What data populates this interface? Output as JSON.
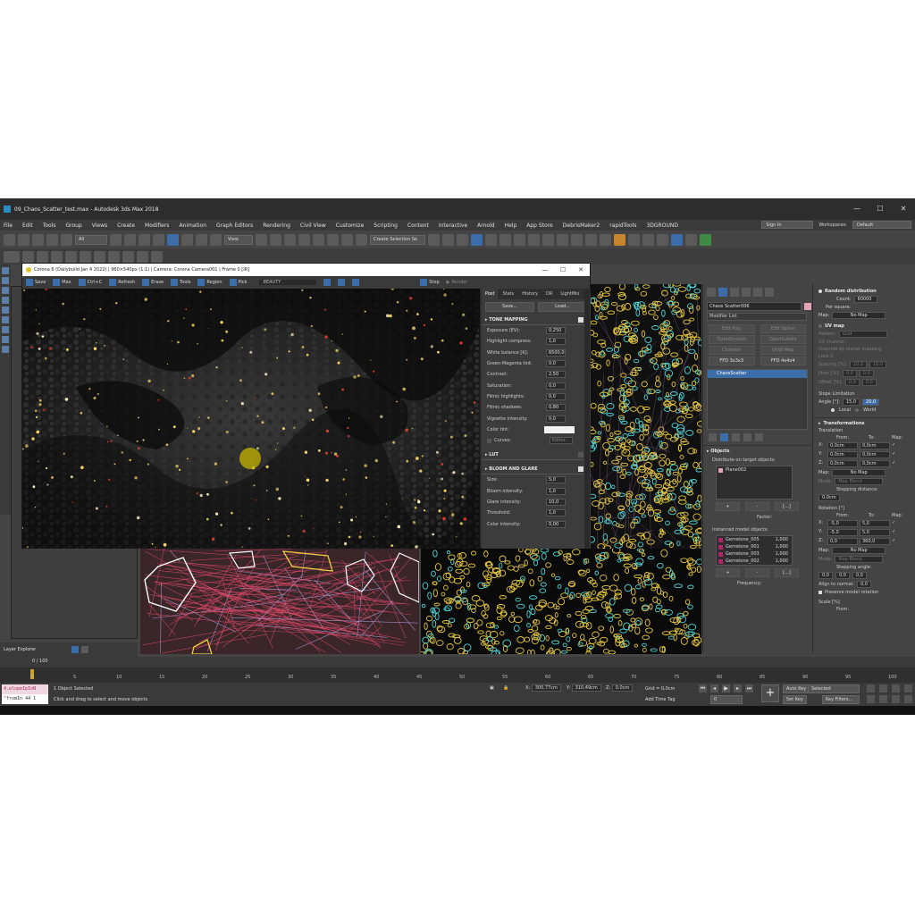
{
  "window": {
    "title": "09_Chaos_Scatter_test.max - Autodesk 3ds Max 2018",
    "controls": [
      "—",
      "☐",
      "✕"
    ]
  },
  "menu": {
    "items": [
      "File",
      "Edit",
      "Tools",
      "Group",
      "Views",
      "Create",
      "Modifiers",
      "Animation",
      "Graph Editors",
      "Rendering",
      "Civil View",
      "Customize",
      "Scripting",
      "Content",
      "Interactive",
      "Arnold",
      "Help",
      "App Store",
      "DebrisMaker2",
      "rapidTools",
      "3DGROUND"
    ],
    "signin": "Sign In",
    "workspaces_label": "Workspaces:",
    "workspaces_value": "Default"
  },
  "toolbar": {
    "filter": "All",
    "view": "View",
    "selection_set": "Create Selection Se"
  },
  "vfb": {
    "title": "Corona 6 (Dailybuild Jan 4 2022) | 960×540px (1:1) | Camera: Corona Camera001 | Frame 0 [IR]",
    "tools": [
      "Save",
      "Max",
      "Ctrl+C",
      "Refresh",
      "Erase",
      "Tools",
      "Region",
      "Pick"
    ],
    "channel": "BEAUTY",
    "stop": "Stop",
    "render": "Render",
    "tabs": [
      "Post",
      "Stats",
      "History",
      "DR",
      "LightMix"
    ],
    "save_btn": "Save...",
    "load_btn": "Load...",
    "tone_mapping": "TONE MAPPING",
    "tone_rows": [
      {
        "label": "Exposure (EV):",
        "value": "0,250"
      },
      {
        "label": "Highlight compress:",
        "value": "1,0"
      },
      {
        "label": "White balance [K]:",
        "value": "6500,0"
      },
      {
        "label": "Green-Magenta tint:",
        "value": "0,0"
      },
      {
        "label": "Contrast:",
        "value": "2,50"
      },
      {
        "label": "Saturation:",
        "value": "0,0"
      },
      {
        "label": "Filmic highlights:",
        "value": "0,0"
      },
      {
        "label": "Filmic shadows:",
        "value": "0,80"
      },
      {
        "label": "Vignette intensity:",
        "value": "0,0"
      }
    ],
    "color_tint": "Color tint:",
    "curves": "Curves:",
    "curves_btn": "Editor...",
    "lut": "LUT",
    "bloom": "BLOOM AND GLARE",
    "bloom_rows": [
      {
        "label": "Size:",
        "value": "5,0"
      },
      {
        "label": "Bloom intensity:",
        "value": "1,0"
      },
      {
        "label": "Glare intensity:",
        "value": "10,0"
      },
      {
        "label": "Threshold:",
        "value": "1,0"
      },
      {
        "label": "Color intensity:",
        "value": "0,00"
      }
    ]
  },
  "command_panel": {
    "object_name": "Chaos Scatter006",
    "modifier_list": "Modifier List",
    "buttons": [
      {
        "label": "Edit Poly",
        "enabled": false
      },
      {
        "label": "Edit Spline",
        "enabled": false
      },
      {
        "label": "TurboSmooth",
        "enabled": false
      },
      {
        "label": "OpenSubdiv",
        "enabled": false
      },
      {
        "label": "Chamfer",
        "enabled": false
      },
      {
        "label": "UVW Map",
        "enabled": false
      },
      {
        "label": "FFD 3x3x3",
        "enabled": true
      },
      {
        "label": "FFD 4x4x4",
        "enabled": true
      }
    ],
    "stack_item": "ChaosScatter",
    "objects_title": "Objects",
    "distribute_label": "Distribute-on target objects:",
    "target": "Plane002",
    "add": "+",
    "remove": "-",
    "more": "[...]",
    "factor": "Factor:",
    "instanced_label": "Instanced model objects:",
    "instanced": [
      {
        "name": "Gemstone_005",
        "value": "1,000"
      },
      {
        "name": "Gemstone_001",
        "value": "1,000"
      },
      {
        "name": "Gemstone_003",
        "value": "1,000"
      },
      {
        "name": "Gemstone_002",
        "value": "1,000"
      }
    ],
    "frequency": "Frequency:"
  },
  "params": {
    "random_distribution": "Random distribution",
    "count_label": "Count:",
    "count": "60000",
    "per_square": "Per square:",
    "map_label": "Map:",
    "no_map": "No Map",
    "uv_map": "UV map",
    "pattern_label": "Pattern:",
    "pattern": "Grid",
    "uv_channel": "UV channel:",
    "override": "Override by planar mapping",
    "lock": "Lock U",
    "spacing": "Spacing [%]:",
    "spacing_v": [
      "10,0",
      "10,0"
    ],
    "jitter": "Jitter [%]:",
    "jitter_v": [
      "0,0",
      "0,0"
    ],
    "offset": "Offset [%]:",
    "offset_v": [
      "0,0",
      "0,0"
    ],
    "slope": "Slope Limitation",
    "angle_label": "Angle [°]:",
    "angle_from": "15,0",
    "angle_to": "20,0",
    "local": "Local",
    "world": "World",
    "transformations": "Transformations",
    "translation": "Translation",
    "from": "From:",
    "to": "To:",
    "map_col": "Map:",
    "translation_rows": [
      {
        "axis": "X:",
        "from": "0,0cm",
        "to": "0,0cm"
      },
      {
        "axis": "Y:",
        "from": "0,0cm",
        "to": "0,0cm"
      },
      {
        "axis": "Z:",
        "from": "0,0cm",
        "to": "0,0cm"
      }
    ],
    "mode_label": "Mode:",
    "mode": "Map Blend",
    "stepping_distance": "Stepping distance:",
    "stepping_distance_v": "0,0cm",
    "rotation": "Rotation [°]",
    "rotation_rows": [
      {
        "axis": "X:",
        "from": "-5,0",
        "to": "5,0"
      },
      {
        "axis": "Y:",
        "from": "-5,0",
        "to": "5,0"
      },
      {
        "axis": "Z:",
        "from": "0,0",
        "to": "360,0"
      }
    ],
    "stepping_angle": "Stepping angle:",
    "stepping_angle_v": [
      "0,0",
      "0,0",
      "0,0"
    ],
    "align_normal": "Align to normal:",
    "align_normal_v": "0,0",
    "preserve": "Preserve model rotation",
    "scale": "Scale [%]"
  },
  "bottom": {
    "layer_explorer": "Layer Explorer",
    "frame": "0 / 100",
    "ticks": [
      "0",
      "5",
      "10",
      "15",
      "20",
      "25",
      "30",
      "35",
      "40",
      "45",
      "50",
      "55",
      "60",
      "65",
      "70",
      "75",
      "80",
      "85",
      "90",
      "95",
      "100"
    ],
    "maxscript_top": "4.elopeIpIoN",
    "maxscript_bottom": "\"fromIn 44 1",
    "selected": "1 Object Selected",
    "hint": "Click and drag to select and move objects",
    "x_label": "X:",
    "x": "300,77cm",
    "y_label": "Y:",
    "y": "310,49cm",
    "z_label": "Z:",
    "z": "0,0cm",
    "grid": "Grid = 0,0cm",
    "add_time_tag": "Add Time Tag",
    "auto_key": "Auto Key",
    "set_key": "Set Key",
    "selected_dd": "Selected",
    "key_filters": "Key Filters...",
    "frame_field": "0"
  }
}
